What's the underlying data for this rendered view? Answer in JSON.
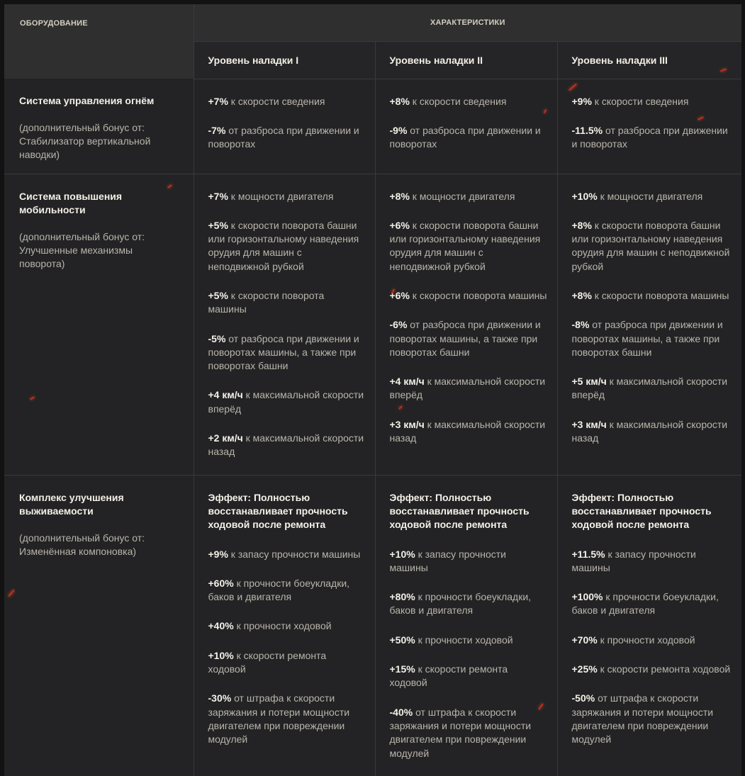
{
  "header": {
    "equipment_label": "ОБОРУДОВАНИЕ",
    "characteristics_label": "ХАРАКТЕРИСТИКИ",
    "levels": [
      "Уровень наладки I",
      "Уровень наладки II",
      "Уровень наладки III"
    ]
  },
  "rows": [
    {
      "name": "Система управления огнём",
      "note": "(дополнительный бонус от: Стабилизатор вертикальной наводки)",
      "levels": [
        [
          {
            "v": "+7%",
            "t": " к скорости сведения"
          },
          {
            "v": "-7%",
            "t": " от разброса при движении и поворотах"
          }
        ],
        [
          {
            "v": "+8%",
            "t": " к скорости сведения"
          },
          {
            "v": "-9%",
            "t": " от разброса при движении и поворотах"
          }
        ],
        [
          {
            "v": "+9%",
            "t": " к скорости сведения"
          },
          {
            "v": "-11.5%",
            "t": " от разброса при движении и поворотах"
          }
        ]
      ]
    },
    {
      "name": "Система повышения мобильности",
      "note": "(дополнительный бонус от: Улучшенные механизмы поворота)",
      "levels": [
        [
          {
            "v": "+7%",
            "t": " к мощности двигателя"
          },
          {
            "v": "+5%",
            "t": " к скорости поворота башни или горизонтальному наведения орудия для машин с неподвижной рубкой"
          },
          {
            "v": "+5%",
            "t": " к скорости поворота машины"
          },
          {
            "v": "-5%",
            "t": " от разброса при движении и поворотах машины, а также при поворотах башни"
          },
          {
            "v": "+4 км/ч",
            "t": " к максимальной скорости вперёд"
          },
          {
            "v": "+2 км/ч",
            "t": " к максимальной скорости назад"
          }
        ],
        [
          {
            "v": "+8%",
            "t": " к мощности двигателя"
          },
          {
            "v": "+6%",
            "t": " к скорости поворота башни или горизонтальному наведения орудия для машин с неподвижной рубкой"
          },
          {
            "v": "+6%",
            "t": " к скорости поворота машины"
          },
          {
            "v": "-6%",
            "t": " от разброса при движении и поворотах машины, а также при поворотах башни"
          },
          {
            "v": "+4 км/ч",
            "t": " к максимальной скорости вперёд"
          },
          {
            "v": "+3 км/ч",
            "t": " к максимальной скорости назад"
          }
        ],
        [
          {
            "v": "+10%",
            "t": " к мощности двигателя"
          },
          {
            "v": "+8%",
            "t": " к скорости поворота башни или горизонтальному наведения орудия для машин с неподвижной рубкой"
          },
          {
            "v": "+8%",
            "t": " к скорости поворота машины"
          },
          {
            "v": "-8%",
            "t": " от разброса при движении и поворотах машины, а также при поворотах башни"
          },
          {
            "v": "+5 км/ч",
            "t": " к максимальной скорости вперёд"
          },
          {
            "v": "+3 км/ч",
            "t": " к максимальной скорости назад"
          }
        ]
      ]
    },
    {
      "name": "Комплекс улучшения выживаемости",
      "note": "(дополнительный бонус от: Изменённая компоновка)",
      "levels": [
        [
          {
            "effect": "Эффект: Полностью восстанавливает прочность ходовой после ремонта"
          },
          {
            "v": "+9%",
            "t": " к запасу прочности машины"
          },
          {
            "v": "+60%",
            "t": " к прочности боеукладки, баков и двигателя"
          },
          {
            "v": "+40%",
            "t": " к прочности ходовой"
          },
          {
            "v": "+10%",
            "t": " к скорости ремонта ходовой"
          },
          {
            "v": "-30%",
            "t": " от штрафа к скорости заряжания и потери мощности двигателем при повреждении модулей"
          }
        ],
        [
          {
            "effect": "Эффект: Полностью восстанавливает прочность ходовой после ремонта"
          },
          {
            "v": "+10%",
            "t": " к запасу прочности машины"
          },
          {
            "v": "+80%",
            "t": " к прочности боеукладки, баков и двигателя"
          },
          {
            "v": "+50%",
            "t": " к прочности ходовой"
          },
          {
            "v": "+15%",
            "t": " к скорости ремонта ходовой"
          },
          {
            "v": "-40%",
            "t": " от штрафа к скорости заряжания и потери мощности двигателем при повреждении модулей"
          }
        ],
        [
          {
            "effect": "Эффект: Полностью восстанавливает прочность ходовой после ремонта"
          },
          {
            "v": "+11.5%",
            "t": " к запасу прочности машины"
          },
          {
            "v": "+100%",
            "t": " к прочности боеукладки, баков и двигателя"
          },
          {
            "v": "+70%",
            "t": " к прочности ходовой"
          },
          {
            "v": "+25%",
            "t": " к скорости ремонта ходовой"
          },
          {
            "v": "-50%",
            "t": " от штрафа к скорости заряжания и потери мощности двигателем при повреждении модулей"
          }
        ]
      ]
    }
  ]
}
